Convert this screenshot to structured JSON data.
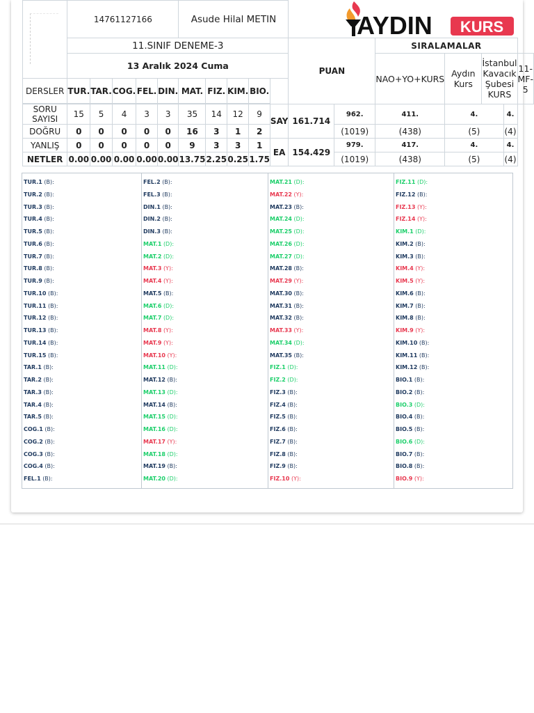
{
  "student": {
    "number": "14761127166",
    "name": "Asude Hilal METIN"
  },
  "exam": {
    "title": "11.SINIF DENEME-3",
    "date": "13 Aralık 2024 Cuma"
  },
  "brand": {
    "logo_text_main": "AYDIN",
    "logo_text_badge": "KURS",
    "color_red": "#e8384f",
    "color_green": "#1dcf6b",
    "color_navy": "#1f3a5f"
  },
  "labels": {
    "dersler": "DERSLER",
    "puan": "PUAN",
    "siralamalar": "SIRALAMALAR",
    "soru_sayisi": "SORU SAYISI",
    "dogru": "DOĞRU",
    "yanlis": "YANLIŞ",
    "netler": "NETLER"
  },
  "subjects": [
    "TUR.",
    "TAR.",
    "COG.",
    "FEL.",
    "DIN.",
    "MAT.",
    "FIZ.",
    "KIM.",
    "BIO."
  ],
  "results": {
    "soru": [
      "15",
      "5",
      "4",
      "3",
      "3",
      "35",
      "14",
      "12",
      "9"
    ],
    "dogru": [
      "0",
      "0",
      "0",
      "0",
      "0",
      "16",
      "3",
      "1",
      "2"
    ],
    "yanlis": [
      "0",
      "0",
      "0",
      "0",
      "0",
      "9",
      "3",
      "3",
      "1"
    ],
    "net": [
      "0.00",
      "0.00",
      "0.00",
      "0.00",
      "0.00",
      "13.75",
      "2.25",
      "0.25",
      "1.75"
    ]
  },
  "scores": [
    {
      "type": "SAY",
      "value": "161.714"
    },
    {
      "type": "EA",
      "value": "154.429"
    }
  ],
  "ranking_headers": [
    "NAO+YO+KURS",
    "Aydın Kurs",
    "İstanbul Kavacık Şubesi KURS",
    "11-MF-5"
  ],
  "rankings": [
    {
      "ranks": [
        "962.",
        "411.",
        "4.",
        "4."
      ],
      "counts": [
        "(1019)",
        "(438)",
        "(5)",
        "(4)"
      ]
    },
    {
      "ranks": [
        "979.",
        "417.",
        "4.",
        "4."
      ],
      "counts": [
        "(1019)",
        "(438)",
        "(5)",
        "(4)"
      ]
    }
  ],
  "answer_columns": [
    [
      {
        "code": "TUR.1",
        "mark": "(B):",
        "s": "B"
      },
      {
        "code": "TUR.2",
        "mark": "(B):",
        "s": "B"
      },
      {
        "code": "TUR.3",
        "mark": "(B):",
        "s": "B"
      },
      {
        "code": "TUR.4",
        "mark": "(B):",
        "s": "B"
      },
      {
        "code": "TUR.5",
        "mark": "(B):",
        "s": "B"
      },
      {
        "code": "TUR.6",
        "mark": "(B):",
        "s": "B"
      },
      {
        "code": "TUR.7",
        "mark": "(B):",
        "s": "B"
      },
      {
        "code": "TUR.8",
        "mark": "(B):",
        "s": "B"
      },
      {
        "code": "TUR.9",
        "mark": "(B):",
        "s": "B"
      },
      {
        "code": "TUR.10",
        "mark": "(B):",
        "s": "B"
      },
      {
        "code": "TUR.11",
        "mark": "(B):",
        "s": "B"
      },
      {
        "code": "TUR.12",
        "mark": "(B):",
        "s": "B"
      },
      {
        "code": "TUR.13",
        "mark": "(B):",
        "s": "B"
      },
      {
        "code": "TUR.14",
        "mark": "(B):",
        "s": "B"
      },
      {
        "code": "TUR.15",
        "mark": "(B):",
        "s": "B"
      },
      {
        "code": "TAR.1",
        "mark": "(B):",
        "s": "B"
      },
      {
        "code": "TAR.2",
        "mark": "(B):",
        "s": "B"
      },
      {
        "code": "TAR.3",
        "mark": "(B):",
        "s": "B"
      },
      {
        "code": "TAR.4",
        "mark": "(B):",
        "s": "B"
      },
      {
        "code": "TAR.5",
        "mark": "(B):",
        "s": "B"
      },
      {
        "code": "COG.1",
        "mark": "(B):",
        "s": "B"
      },
      {
        "code": "COG.2",
        "mark": "(B):",
        "s": "B"
      },
      {
        "code": "COG.3",
        "mark": "(B):",
        "s": "B"
      },
      {
        "code": "COG.4",
        "mark": "(B):",
        "s": "B"
      },
      {
        "code": "FEL.1",
        "mark": "(B):",
        "s": "B"
      }
    ],
    [
      {
        "code": "FEL.2",
        "mark": "(B):",
        "s": "B"
      },
      {
        "code": "FEL.3",
        "mark": "(B):",
        "s": "B"
      },
      {
        "code": "DIN.1",
        "mark": "(B):",
        "s": "B"
      },
      {
        "code": "DIN.2",
        "mark": "(B):",
        "s": "B"
      },
      {
        "code": "DIN.3",
        "mark": "(B):",
        "s": "B"
      },
      {
        "code": "MAT.1",
        "mark": "(D):",
        "s": "D"
      },
      {
        "code": "MAT.2",
        "mark": "(D):",
        "s": "D"
      },
      {
        "code": "MAT.3",
        "mark": "(Y):",
        "s": "Y"
      },
      {
        "code": "MAT.4",
        "mark": "(Y):",
        "s": "Y"
      },
      {
        "code": "MAT.5",
        "mark": "(B):",
        "s": "B"
      },
      {
        "code": "MAT.6",
        "mark": "(D):",
        "s": "D"
      },
      {
        "code": "MAT.7",
        "mark": "(D):",
        "s": "D"
      },
      {
        "code": "MAT.8",
        "mark": "(Y):",
        "s": "Y"
      },
      {
        "code": "MAT.9",
        "mark": "(Y):",
        "s": "Y"
      },
      {
        "code": "MAT.10",
        "mark": "(Y):",
        "s": "Y"
      },
      {
        "code": "MAT.11",
        "mark": "(D):",
        "s": "D"
      },
      {
        "code": "MAT.12",
        "mark": "(B):",
        "s": "B"
      },
      {
        "code": "MAT.13",
        "mark": "(D):",
        "s": "D"
      },
      {
        "code": "MAT.14",
        "mark": "(B):",
        "s": "B"
      },
      {
        "code": "MAT.15",
        "mark": "(D):",
        "s": "D"
      },
      {
        "code": "MAT.16",
        "mark": "(D):",
        "s": "D"
      },
      {
        "code": "MAT.17",
        "mark": "(Y):",
        "s": "Y"
      },
      {
        "code": "MAT.18",
        "mark": "(D):",
        "s": "D"
      },
      {
        "code": "MAT.19",
        "mark": "(B):",
        "s": "B"
      },
      {
        "code": "MAT.20",
        "mark": "(D):",
        "s": "D"
      }
    ],
    [
      {
        "code": "MAT.21",
        "mark": "(D):",
        "s": "D"
      },
      {
        "code": "MAT.22",
        "mark": "(Y):",
        "s": "Y"
      },
      {
        "code": "MAT.23",
        "mark": "(B):",
        "s": "B"
      },
      {
        "code": "MAT.24",
        "mark": "(D):",
        "s": "D"
      },
      {
        "code": "MAT.25",
        "mark": "(D):",
        "s": "D"
      },
      {
        "code": "MAT.26",
        "mark": "(D):",
        "s": "D"
      },
      {
        "code": "MAT.27",
        "mark": "(D):",
        "s": "D"
      },
      {
        "code": "MAT.28",
        "mark": "(B):",
        "s": "B"
      },
      {
        "code": "MAT.29",
        "mark": "(Y):",
        "s": "Y"
      },
      {
        "code": "MAT.30",
        "mark": "(B):",
        "s": "B"
      },
      {
        "code": "MAT.31",
        "mark": "(B):",
        "s": "B"
      },
      {
        "code": "MAT.32",
        "mark": "(B):",
        "s": "B"
      },
      {
        "code": "MAT.33",
        "mark": "(Y):",
        "s": "Y"
      },
      {
        "code": "MAT.34",
        "mark": "(D):",
        "s": "D"
      },
      {
        "code": "MAT.35",
        "mark": "(B):",
        "s": "B"
      },
      {
        "code": "FIZ.1",
        "mark": "(D):",
        "s": "D"
      },
      {
        "code": "FIZ.2",
        "mark": "(D):",
        "s": "D"
      },
      {
        "code": "FIZ.3",
        "mark": "(B):",
        "s": "B"
      },
      {
        "code": "FIZ.4",
        "mark": "(B):",
        "s": "B"
      },
      {
        "code": "FIZ.5",
        "mark": "(B):",
        "s": "B"
      },
      {
        "code": "FIZ.6",
        "mark": "(B):",
        "s": "B"
      },
      {
        "code": "FIZ.7",
        "mark": "(B):",
        "s": "B"
      },
      {
        "code": "FIZ.8",
        "mark": "(B):",
        "s": "B"
      },
      {
        "code": "FIZ.9",
        "mark": "(B):",
        "s": "B"
      },
      {
        "code": "FIZ.10",
        "mark": "(Y):",
        "s": "Y"
      }
    ],
    [
      {
        "code": "FIZ.11",
        "mark": "(D):",
        "s": "D"
      },
      {
        "code": "FIZ.12",
        "mark": "(B):",
        "s": "B"
      },
      {
        "code": "FIZ.13",
        "mark": "(Y):",
        "s": "Y"
      },
      {
        "code": "FIZ.14",
        "mark": "(Y):",
        "s": "Y"
      },
      {
        "code": "KIM.1",
        "mark": "(D):",
        "s": "D"
      },
      {
        "code": "KIM.2",
        "mark": "(B):",
        "s": "B"
      },
      {
        "code": "KIM.3",
        "mark": "(B):",
        "s": "B"
      },
      {
        "code": "KIM.4",
        "mark": "(Y):",
        "s": "Y"
      },
      {
        "code": "KIM.5",
        "mark": "(Y):",
        "s": "Y"
      },
      {
        "code": "KIM.6",
        "mark": "(B):",
        "s": "B"
      },
      {
        "code": "KIM.7",
        "mark": "(B):",
        "s": "B"
      },
      {
        "code": "KIM.8",
        "mark": "(B):",
        "s": "B"
      },
      {
        "code": "KIM.9",
        "mark": "(Y):",
        "s": "Y"
      },
      {
        "code": "KIM.10",
        "mark": "(B):",
        "s": "B"
      },
      {
        "code": "KIM.11",
        "mark": "(B):",
        "s": "B"
      },
      {
        "code": "KIM.12",
        "mark": "(B):",
        "s": "B"
      },
      {
        "code": "BIO.1",
        "mark": "(B):",
        "s": "B"
      },
      {
        "code": "BIO.2",
        "mark": "(B):",
        "s": "B"
      },
      {
        "code": "BIO.3",
        "mark": "(D):",
        "s": "D"
      },
      {
        "code": "BIO.4",
        "mark": "(B):",
        "s": "B"
      },
      {
        "code": "BIO.5",
        "mark": "(B):",
        "s": "B"
      },
      {
        "code": "BIO.6",
        "mark": "(D):",
        "s": "D"
      },
      {
        "code": "BIO.7",
        "mark": "(B):",
        "s": "B"
      },
      {
        "code": "BIO.8",
        "mark": "(B):",
        "s": "B"
      },
      {
        "code": "BIO.9",
        "mark": "(Y):",
        "s": "Y"
      }
    ]
  ]
}
